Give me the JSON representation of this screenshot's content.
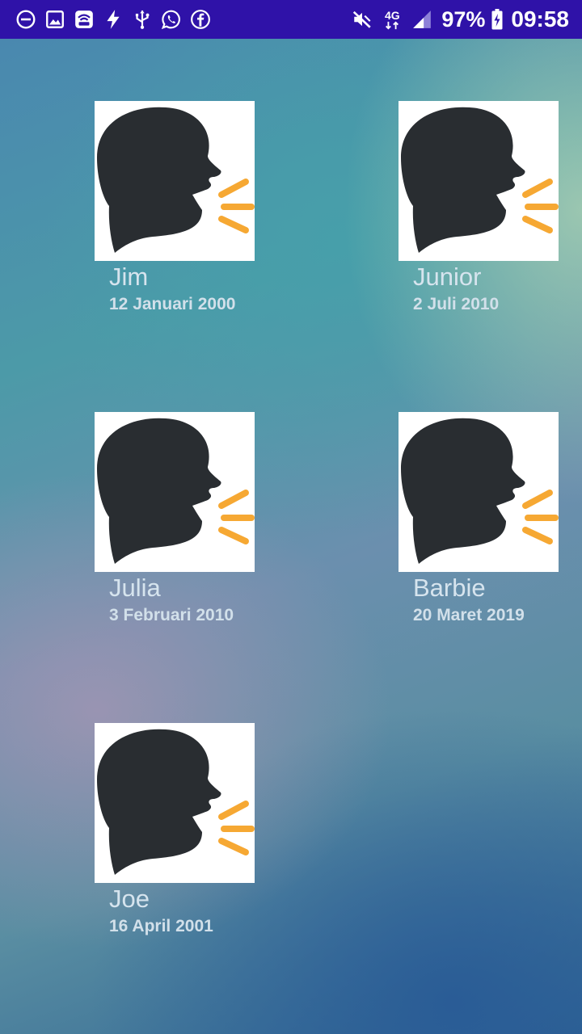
{
  "status_bar": {
    "left_icons": [
      "do-not-disturb-icon",
      "gallery-icon",
      "wifi-hotspot-icon",
      "flash-icon",
      "usb-icon",
      "whatsapp-icon",
      "facebook-icon"
    ],
    "right_icons": [
      "mute-icon",
      "4g-icon",
      "signal-icon",
      "battery-charging-icon"
    ],
    "network_label": "4G",
    "battery_percent": "97%",
    "time": "09:58",
    "background_color": "#2f12a8"
  },
  "contacts": [
    {
      "name": "Jim",
      "date": "12 Januari 2000",
      "icon": "speaking-head-icon"
    },
    {
      "name": "Junior",
      "date": "2 Juli 2010",
      "icon": "speaking-head-icon"
    },
    {
      "name": "Julia",
      "date": "3 Februari 2010",
      "icon": "speaking-head-icon"
    },
    {
      "name": "Barbie",
      "date": "20 Maret 2019",
      "icon": "speaking-head-icon"
    },
    {
      "name": "Joe",
      "date": "16 April 2001",
      "icon": "speaking-head-icon"
    }
  ],
  "colors": {
    "head": "#292d31",
    "sound_waves": "#f6a833",
    "text": "#d6e4ee"
  }
}
